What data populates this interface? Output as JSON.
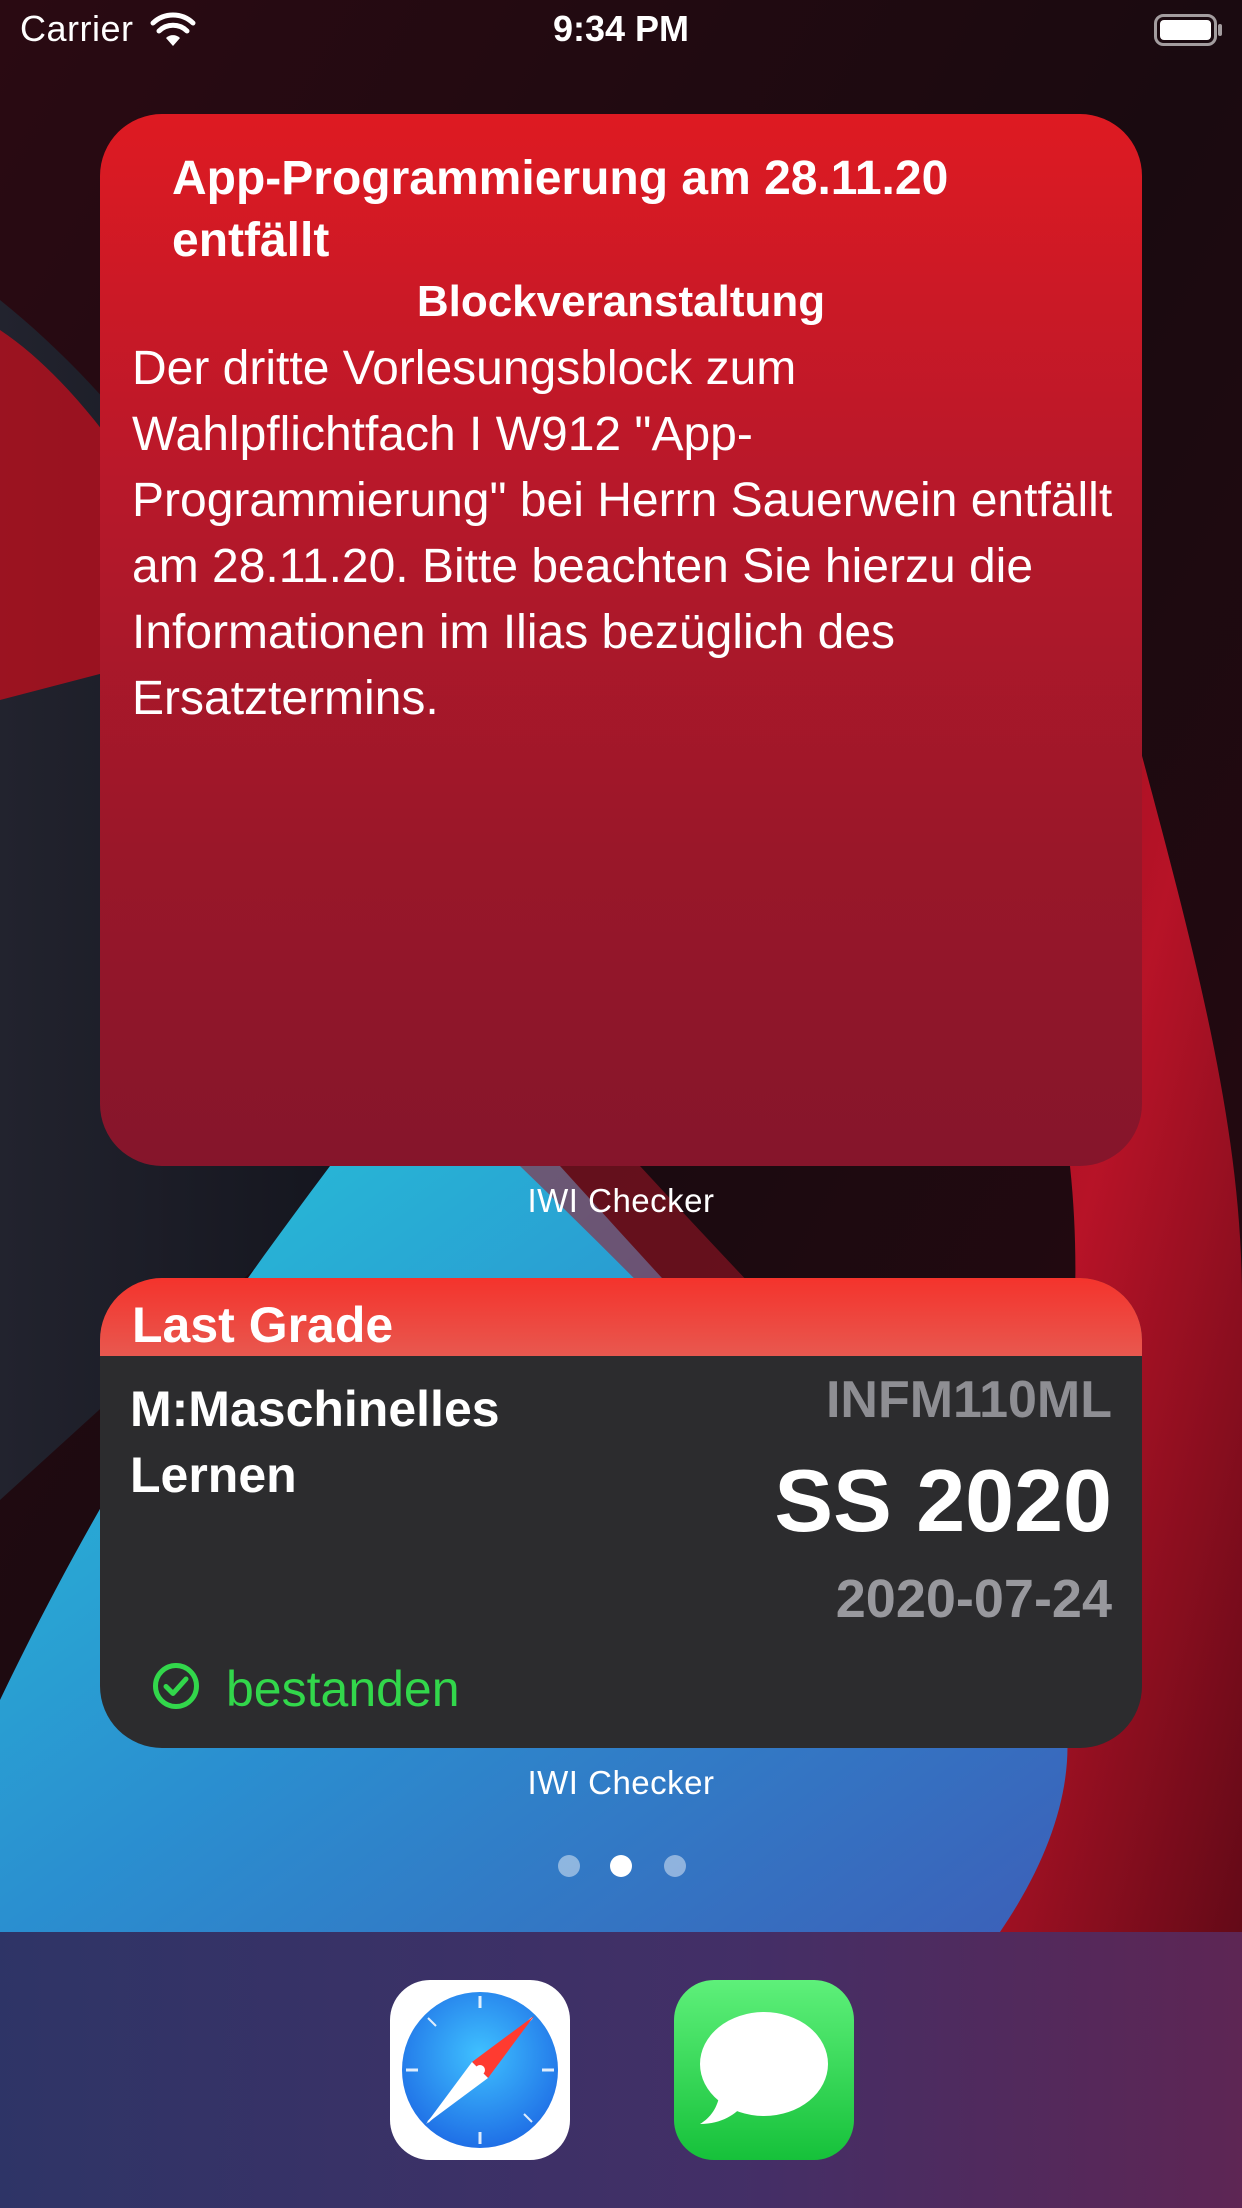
{
  "status_bar": {
    "carrier": "Carrier",
    "time": "9:34 PM"
  },
  "widgets": {
    "news": {
      "title": "App-Programmierung am 28.11.20 entfällt",
      "category": "Blockveranstaltung",
      "body": "Der dritte Vorlesungsblock zum Wahlpflichtfach I W912 \"App-Programmierung\" bei Herrn Sauerwein entfällt am 28.11.20. Bitte beachten Sie hierzu die Informationen im Ilias bezüglich des Ersatztermins.",
      "caption": "IWI Checker",
      "color": "#c8172a"
    },
    "last_grade": {
      "header": "Last Grade",
      "course": "M:Maschinelles Lernen",
      "code": "INFM110ML",
      "semester": "SS 2020",
      "date": "2020-07-24",
      "status": "bestanden",
      "status_icon": "checkmark-circle-icon",
      "caption": "IWI Checker",
      "status_color": "#32d74b",
      "header_color": "#f4332c"
    }
  },
  "page_indicator": {
    "count": 3,
    "current": 2
  },
  "dock": {
    "apps": [
      {
        "name": "Safari",
        "icon": "compass-icon"
      },
      {
        "name": "Messages",
        "icon": "speech-bubble-icon"
      }
    ]
  }
}
